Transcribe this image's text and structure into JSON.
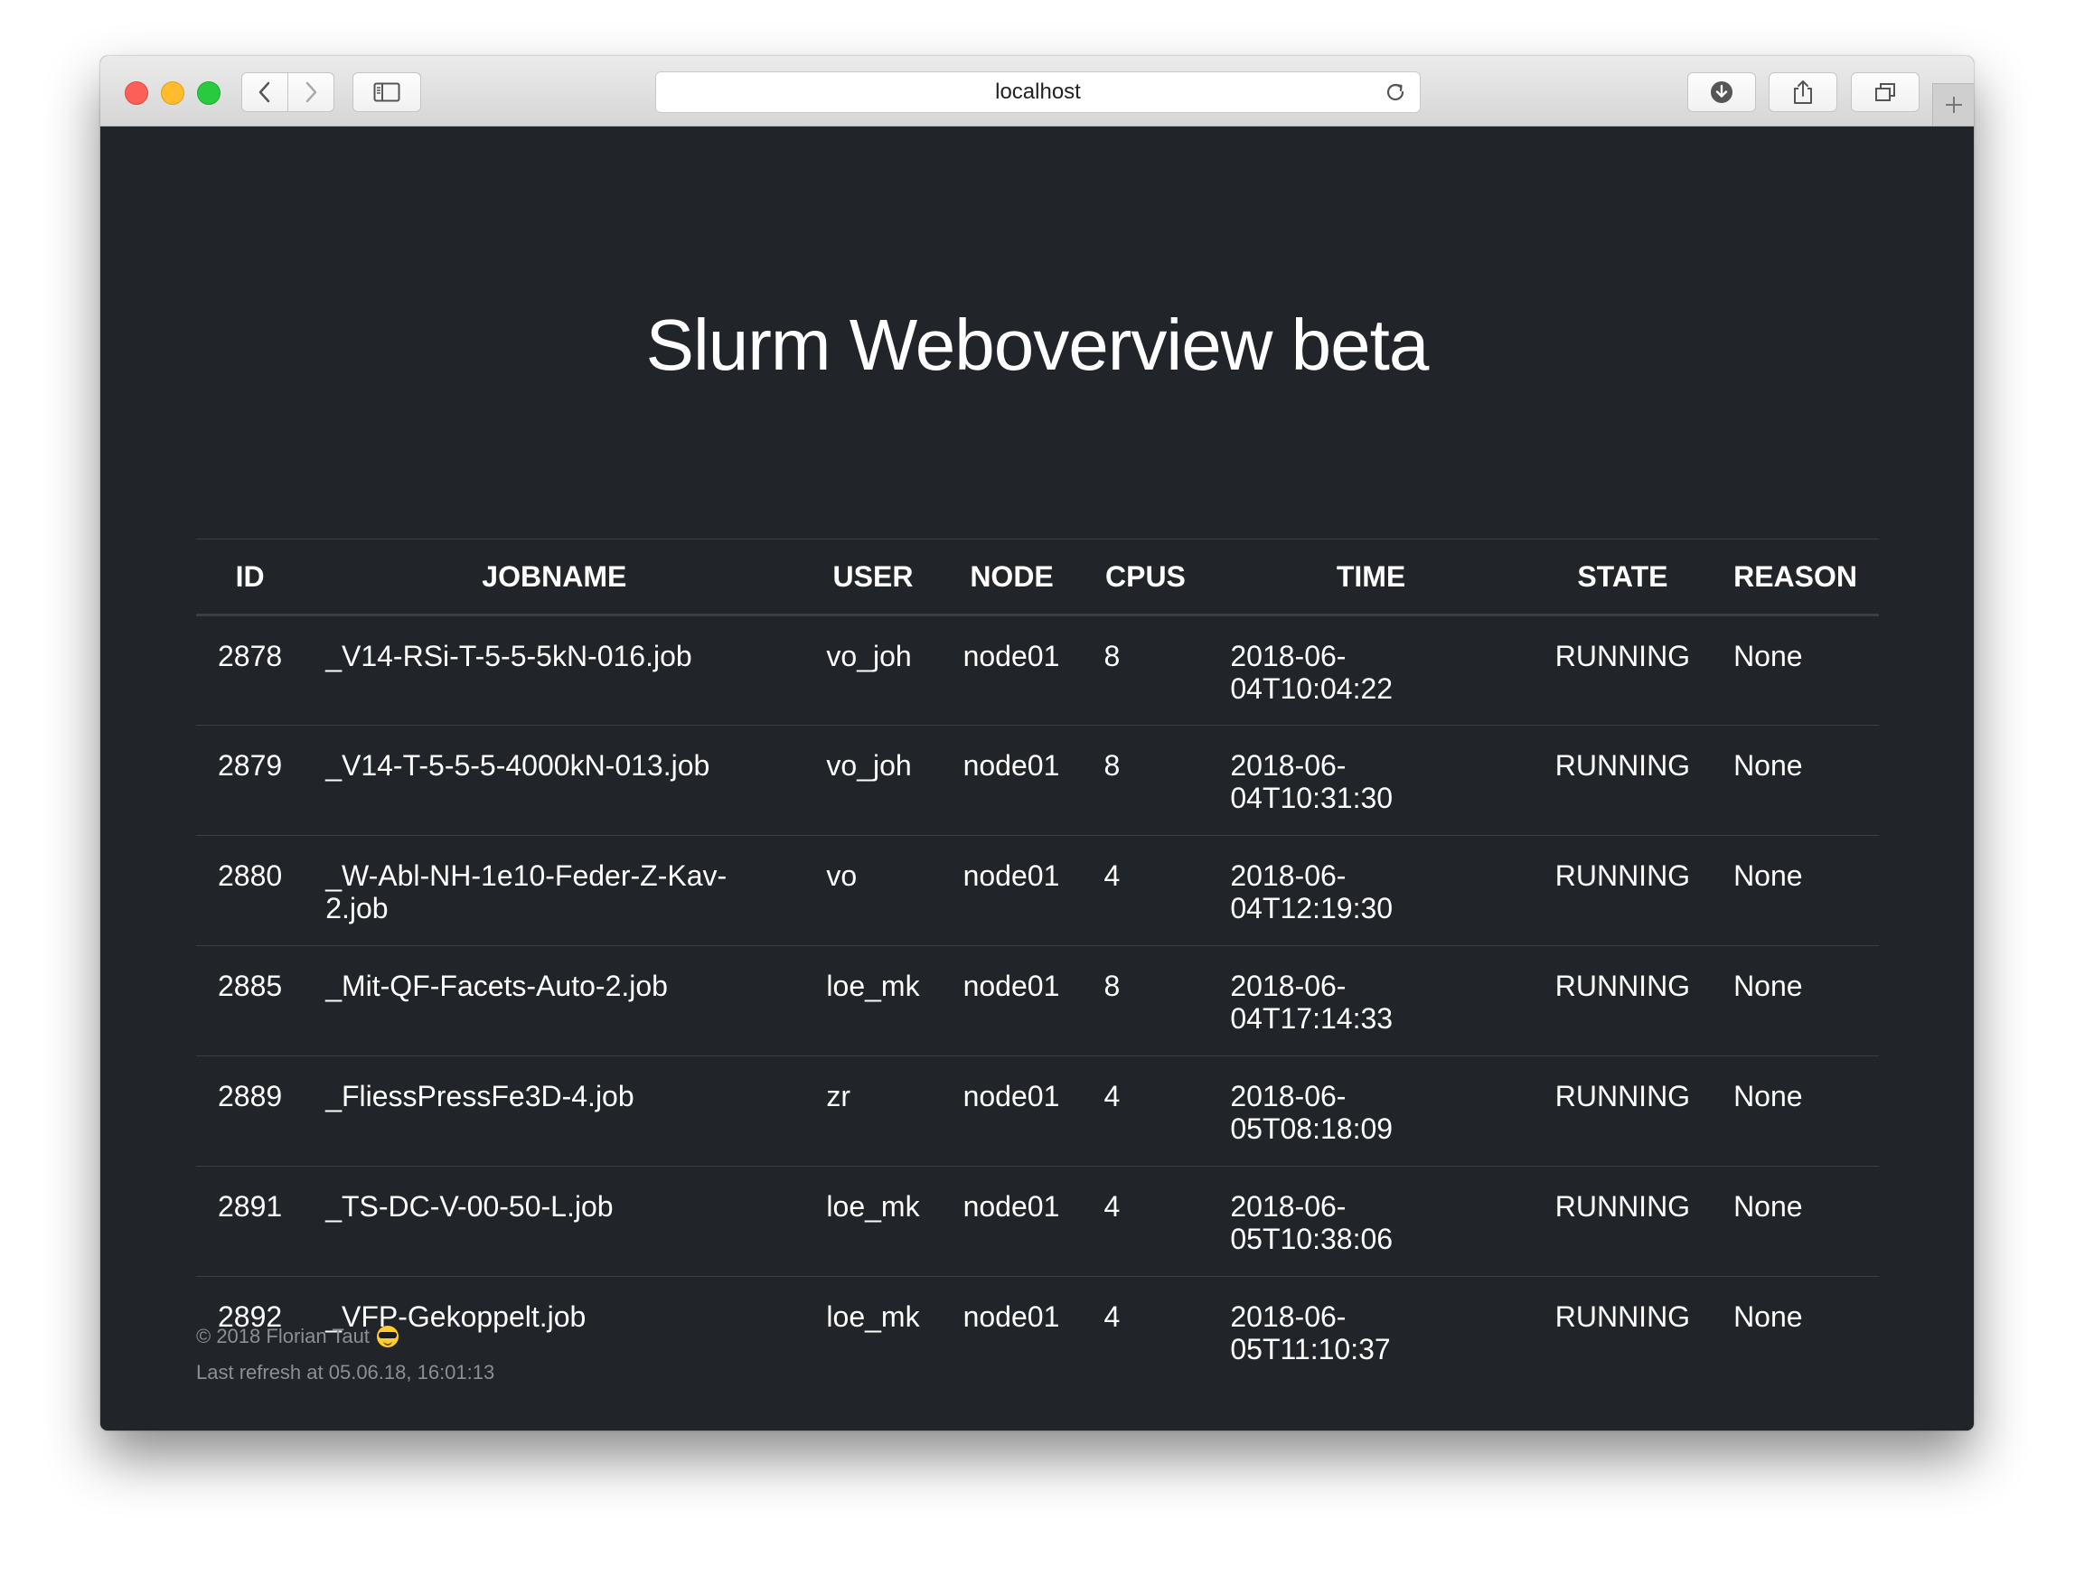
{
  "browser": {
    "url": "localhost"
  },
  "page": {
    "title": "Slurm Weboverview beta"
  },
  "table": {
    "headers": [
      "ID",
      "JOBNAME",
      "USER",
      "NODE",
      "CPUS",
      "TIME",
      "STATE",
      "REASON"
    ],
    "rows": [
      {
        "id": "2878",
        "jobname": "_V14-RSi-T-5-5-5kN-016.job",
        "user": "vo_joh",
        "node": "node01",
        "cpus": "8",
        "time_date": "2018-06-",
        "time_clock": "04T10:04:22",
        "state": "RUNNING",
        "reason": "None"
      },
      {
        "id": "2879",
        "jobname": "_V14-T-5-5-5-4000kN-013.job",
        "user": "vo_joh",
        "node": "node01",
        "cpus": "8",
        "time_date": "2018-06-",
        "time_clock": "04T10:31:30",
        "state": "RUNNING",
        "reason": "None"
      },
      {
        "id": "2880",
        "jobname": "_W-Abl-NH-1e10-Feder-Z-Kav-",
        "jobname_cont": "2.job",
        "user": "vo",
        "node": "node01",
        "cpus": "4",
        "time_date": "2018-06-",
        "time_clock": "04T12:19:30",
        "state": "RUNNING",
        "reason": "None"
      },
      {
        "id": "2885",
        "jobname": "_Mit-QF-Facets-Auto-2.job",
        "user": "loe_mk",
        "node": "node01",
        "cpus": "8",
        "time_date": "2018-06-",
        "time_clock": "04T17:14:33",
        "state": "RUNNING",
        "reason": "None"
      },
      {
        "id": "2889",
        "jobname": "_FliessPressFe3D-4.job",
        "user": "zr",
        "node": "node01",
        "cpus": "4",
        "time_date": "2018-06-",
        "time_clock": "05T08:18:09",
        "state": "RUNNING",
        "reason": "None"
      },
      {
        "id": "2891",
        "jobname": "_TS-DC-V-00-50-L.job",
        "user": "loe_mk",
        "node": "node01",
        "cpus": "4",
        "time_date": "2018-06-",
        "time_clock": "05T10:38:06",
        "state": "RUNNING",
        "reason": "None"
      },
      {
        "id": "2892",
        "jobname": "_VFP-Gekoppelt.job",
        "user": "loe_mk",
        "node": "node01",
        "cpus": "4",
        "time_date": "2018-06-",
        "time_clock": "05T11:10:37",
        "state": "RUNNING",
        "reason": "None"
      }
    ]
  },
  "footer": {
    "copyright": "© 2018 Florian Taut",
    "emoji_icon": "sunglasses-face-icon",
    "refresh": "Last refresh at 05.06.18, 16:01:13"
  }
}
